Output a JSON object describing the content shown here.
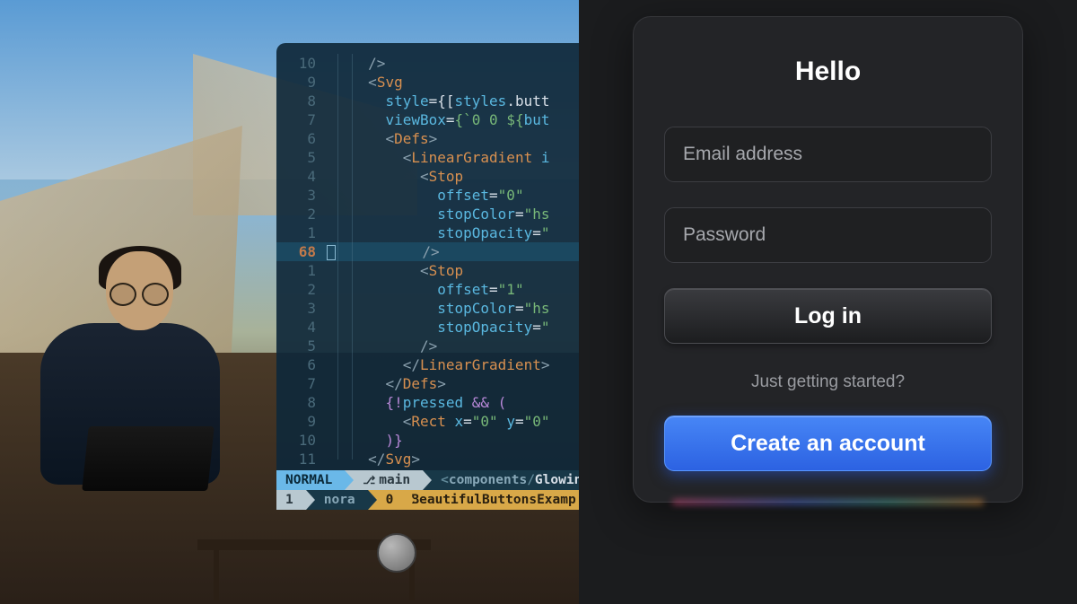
{
  "editor": {
    "gutters": [
      "10",
      "9",
      "8",
      "7",
      "6",
      "5",
      "4",
      "3",
      "2",
      "1",
      "68",
      "1",
      "2",
      "3",
      "4",
      "5",
      "6",
      "7",
      "8",
      "9",
      "10",
      "11"
    ],
    "active_index": 10,
    "status": {
      "mode": "NORMAL",
      "branch": "main",
      "path_prefix": "components",
      "path_file": "Glowing",
      "row2_num": "1",
      "row2_label": "nora",
      "row2_zero": "0",
      "row2_file": "BeautifulButtonsExamp"
    },
    "code": {
      "ln0": "/>",
      "ln1a": "<",
      "ln1b": "Svg",
      "ln2a": "style",
      "ln2b": "={[",
      "ln2c": "styles",
      "ln2d": ".butt",
      "ln3a": "viewBox",
      "ln3b": "=",
      "ln3c": "{`0 0 ${",
      "ln3d": "but",
      "ln4a": "<",
      "ln4b": "Defs",
      "ln4c": ">",
      "ln5a": "<",
      "ln5b": "LinearGradient",
      "ln5c": " i",
      "ln6a": "<",
      "ln6b": "Stop",
      "ln7a": "offset",
      "ln7b": "=",
      "ln7c": "\"0\"",
      "ln8a": "stopColor",
      "ln8b": "=",
      "ln8c": "\"hs",
      "ln9a": "stopOpacity",
      "ln9b": "=",
      "ln9c": "\"",
      "ln10": "/>",
      "ln11a": "<",
      "ln11b": "Stop",
      "ln12a": "offset",
      "ln12b": "=",
      "ln12c": "\"1\"",
      "ln13a": "stopColor",
      "ln13b": "=",
      "ln13c": "\"hs",
      "ln14a": "stopOpacity",
      "ln14b": "=",
      "ln14c": "\"",
      "ln15": "/>",
      "ln16a": "</",
      "ln16b": "LinearGradient",
      "ln16c": ">",
      "ln17a": "</",
      "ln17b": "Defs",
      "ln17c": ">",
      "ln18a": "{!",
      "ln18b": "pressed",
      "ln18c": " && (",
      "ln19a": "<",
      "ln19b": "Rect",
      "ln19c": " x",
      "ln19d": "=",
      "ln19e": "\"0\"",
      "ln19f": " y",
      "ln19g": "=",
      "ln19h": "\"0\"",
      "ln20": ")}",
      "ln21a": "</",
      "ln21b": "Svg",
      "ln21c": ">"
    }
  },
  "login": {
    "title": "Hello",
    "email_placeholder": "Email address",
    "password_placeholder": "Password",
    "login_label": "Log in",
    "hint": "Just getting started?",
    "create_label": "Create an account"
  }
}
